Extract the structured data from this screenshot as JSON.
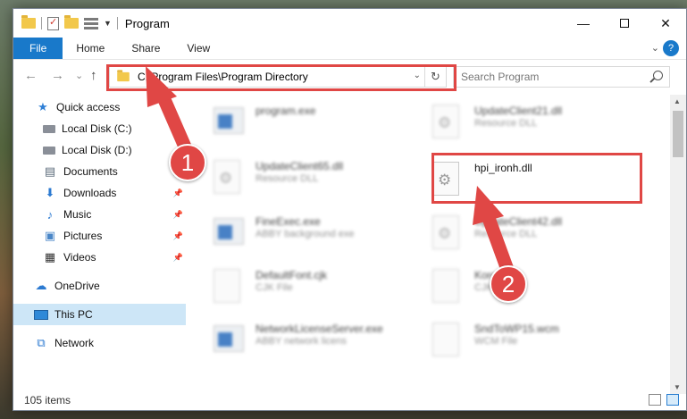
{
  "window": {
    "title": "Program",
    "controls": {
      "minimize": "—",
      "maximize": "",
      "close": "✕"
    }
  },
  "ribbon": {
    "tabs": [
      "File",
      "Home",
      "Share",
      "View"
    ],
    "expand": "⌄",
    "help": "?"
  },
  "navigation": {
    "back": "←",
    "forward": "→",
    "recent": "⌄",
    "up": "↑"
  },
  "address": {
    "path": "C:\\Program Files\\Program Directory",
    "dropdown": "⌄",
    "refresh": "↻"
  },
  "search": {
    "placeholder": "Search Program"
  },
  "sidebar": {
    "items": [
      {
        "label": "Quick access",
        "icon": "star-icon"
      },
      {
        "label": "Local Disk (C:)",
        "icon": "drive-icon"
      },
      {
        "label": "Local Disk (D:)",
        "icon": "drive-icon"
      },
      {
        "label": "Documents",
        "icon": "documents-icon"
      },
      {
        "label": "Downloads",
        "icon": "downloads-icon"
      },
      {
        "label": "Music",
        "icon": "music-icon"
      },
      {
        "label": "Pictures",
        "icon": "pictures-icon"
      },
      {
        "label": "Videos",
        "icon": "videos-icon"
      },
      {
        "label": "OneDrive",
        "icon": "cloud-icon"
      },
      {
        "label": "This PC",
        "icon": "computer-icon"
      },
      {
        "label": "Network",
        "icon": "network-icon"
      }
    ],
    "selected": "This PC"
  },
  "files": [
    {
      "name": "program.exe",
      "desc": "",
      "icon": "app-icon"
    },
    {
      "name": "UpdateClient21.dll",
      "desc": "Resource DLL",
      "icon": "gear-icon"
    },
    {
      "name": "UpdateClient65.dll",
      "desc": "Resource DLL",
      "icon": "gear-icon"
    },
    {
      "name": "hpi_ironh.dll",
      "desc": "",
      "icon": "gear-icon"
    },
    {
      "name": "FineExec.exe",
      "desc": "ABBY background exe",
      "icon": "app-icon"
    },
    {
      "name": "UpdateClient42.dll",
      "desc": "Resource DLL",
      "icon": "gear-icon"
    },
    {
      "name": "DefaultFont.cjk",
      "desc": "CJK File",
      "icon": "file-icon"
    },
    {
      "name": "Korea.cjk",
      "desc": "CJK File",
      "icon": "file-icon"
    },
    {
      "name": "NetworkLicenseServer.exe",
      "desc": "ABBY network licens",
      "icon": "app-icon"
    },
    {
      "name": "SndToWP15.wcm",
      "desc": "WCM File",
      "icon": "file-icon"
    }
  ],
  "status": {
    "items": "105 items"
  },
  "annotations": {
    "step1": "1",
    "step2": "2"
  },
  "colors": {
    "highlight": "#e04745",
    "file_tab": "#1979ca",
    "selected_nav": "#cde6f7"
  }
}
